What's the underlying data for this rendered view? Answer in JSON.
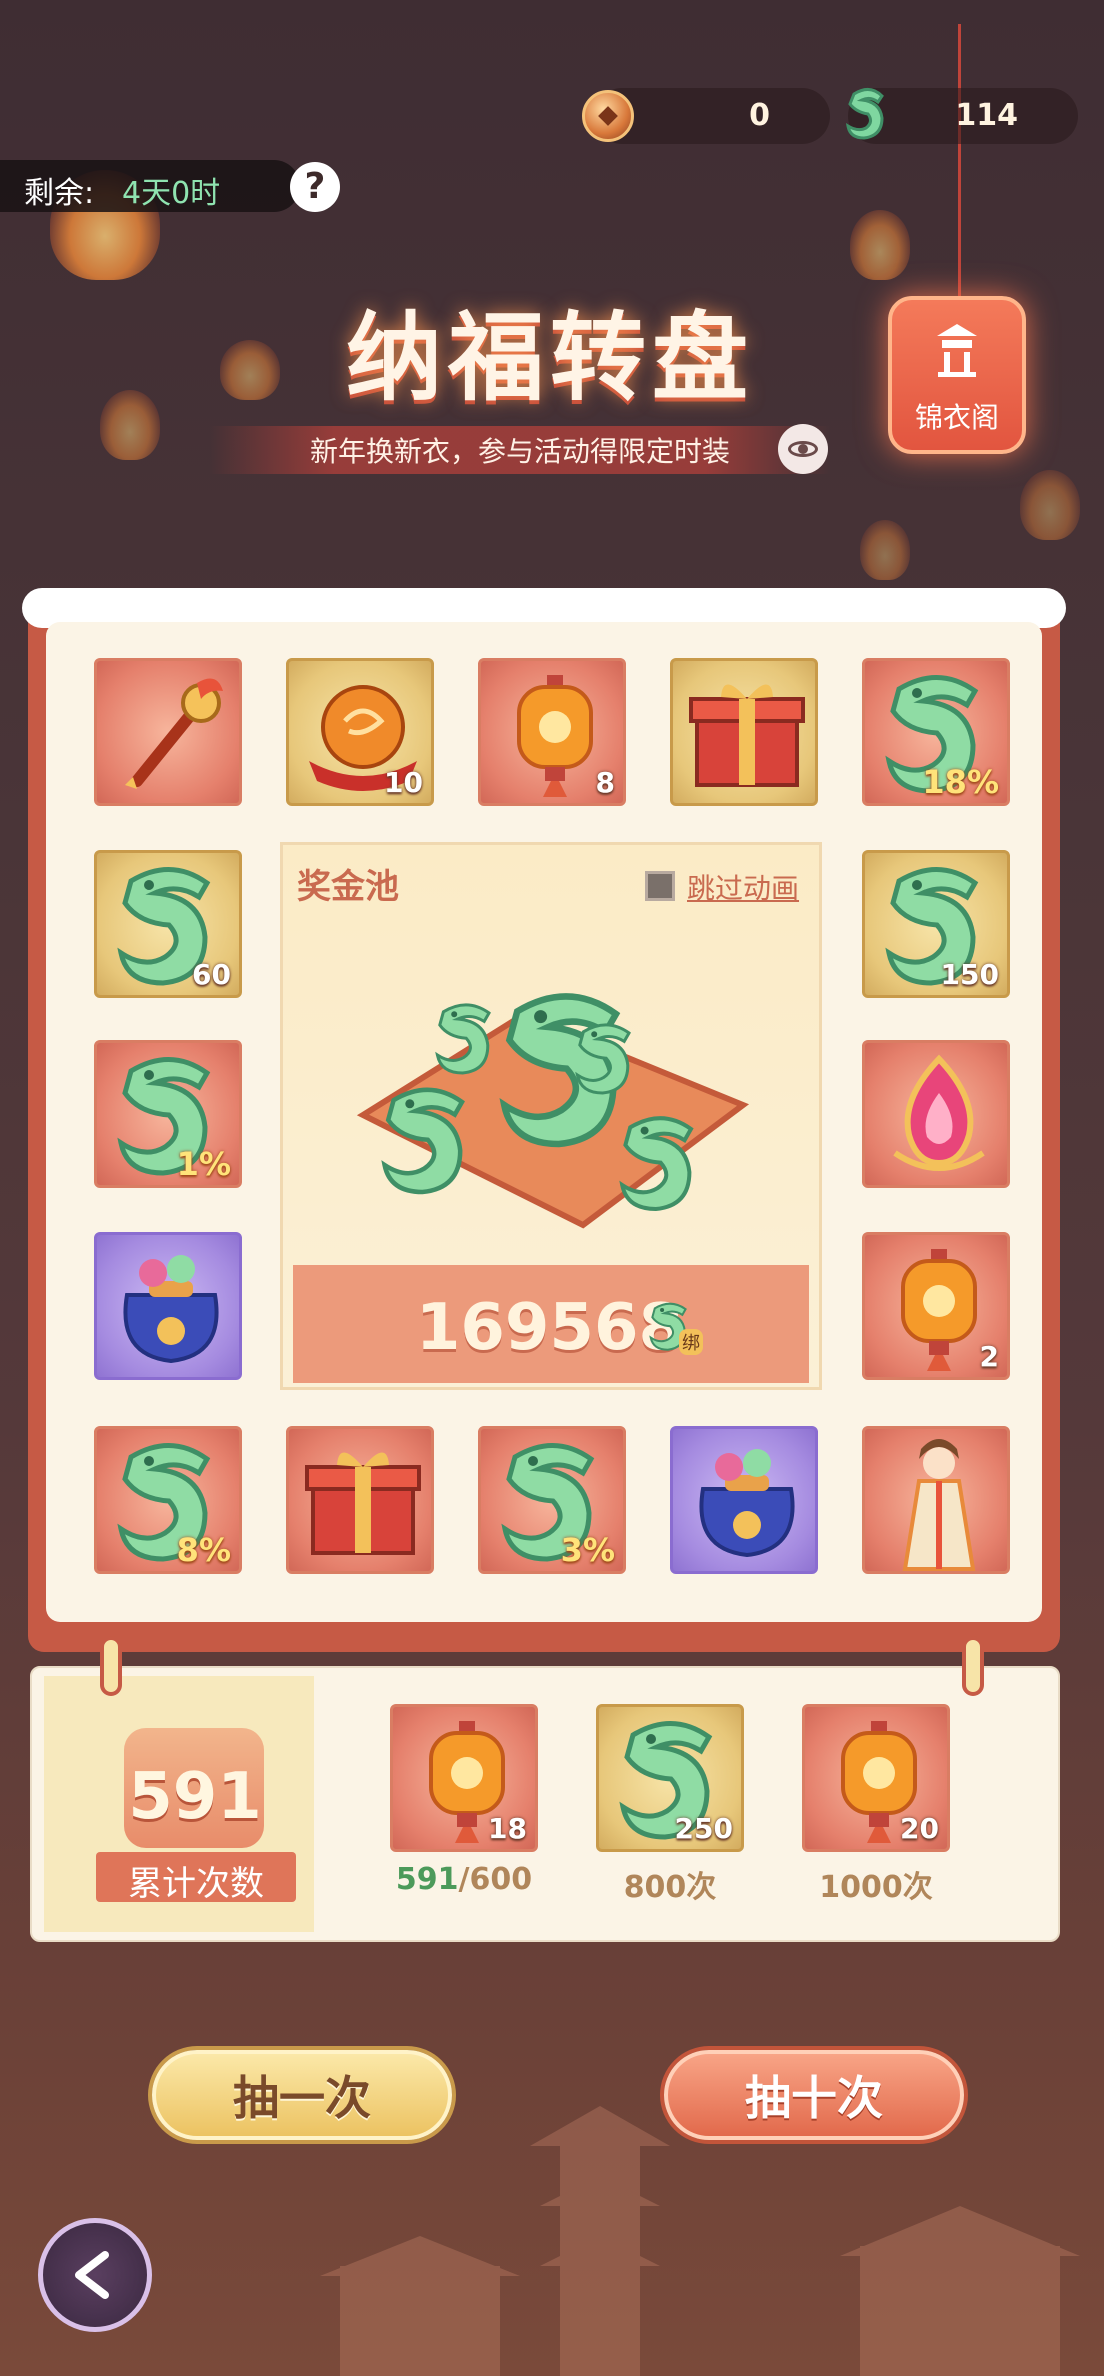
{
  "header": {
    "coins_value": "0",
    "jade_value": "114",
    "remaining_label": "剩余:",
    "remaining_time": "4天0时",
    "help_symbol": "?"
  },
  "title": "纳福转盘",
  "subtitle": "新年换新衣，参与活动得限定时装",
  "wardrobe_label": "锦衣阁",
  "grid": {
    "row1": [
      {
        "icon": "scepter-icon",
        "qty": ""
      },
      {
        "icon": "orb-icon",
        "qty": "10"
      },
      {
        "icon": "lantern-icon",
        "qty": "8"
      },
      {
        "icon": "gift-box-icon",
        "qty": ""
      },
      {
        "icon": "jade-icon",
        "qty": "18%"
      }
    ],
    "left": [
      {
        "icon": "jade-icon",
        "qty": "60"
      },
      {
        "icon": "jade-icon",
        "qty": "1%"
      },
      {
        "icon": "bag-icon",
        "qty": ""
      }
    ],
    "right": [
      {
        "icon": "jade-icon",
        "qty": "150"
      },
      {
        "icon": "flame-crystal-icon",
        "qty": ""
      },
      {
        "icon": "lantern-icon",
        "qty": "2"
      }
    ],
    "row5": [
      {
        "icon": "jade-icon",
        "qty": "8%"
      },
      {
        "icon": "gift-box-icon",
        "qty": ""
      },
      {
        "icon": "jade-icon",
        "qty": "3%"
      },
      {
        "icon": "bag-icon",
        "qty": ""
      },
      {
        "icon": "costume-icon",
        "qty": ""
      }
    ]
  },
  "pool": {
    "title": "奖金池",
    "skip_label": "跳过动画",
    "amount": "169568",
    "bound_tag": "绑"
  },
  "progress": {
    "count": "591",
    "count_label": "累计次数",
    "rewards": [
      {
        "qty": "18",
        "current": "591",
        "target": "/600",
        "label": ""
      },
      {
        "qty": "250",
        "label": "800次"
      },
      {
        "qty": "20",
        "label": "1000次"
      }
    ]
  },
  "buttons": {
    "draw_one": "抽一次",
    "draw_ten": "抽十次"
  },
  "colors": {
    "accent_green": "#8fe3b0",
    "cell_red": "#e5806c",
    "cell_gold": "#e7c77a",
    "cell_purple": "#a58be0"
  }
}
